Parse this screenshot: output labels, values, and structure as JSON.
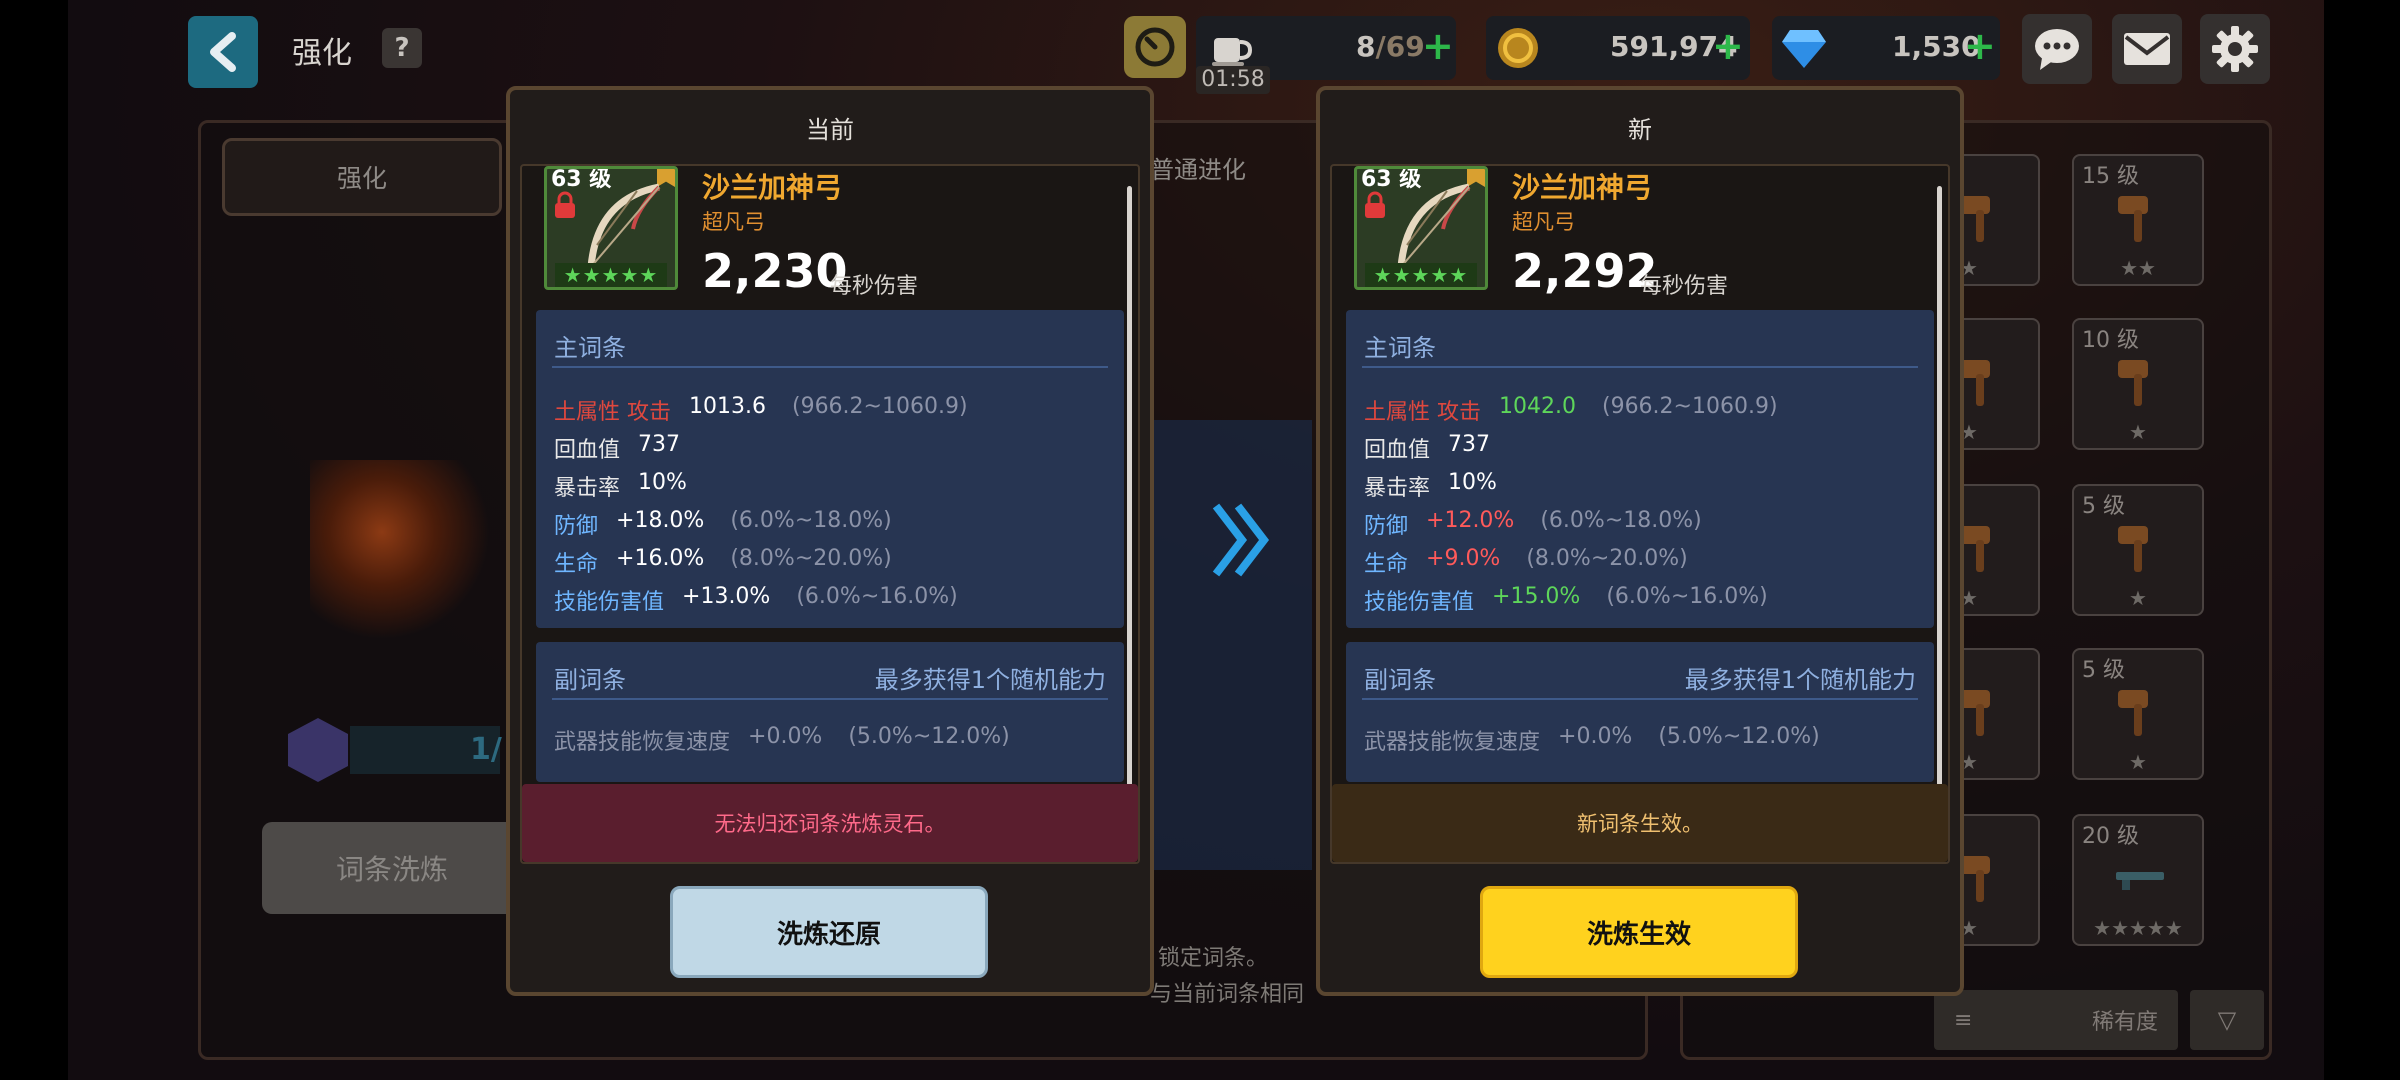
{
  "header": {
    "title": "强化",
    "help": "?",
    "energy": {
      "current": "8",
      "max": "/69",
      "timer": "01:58"
    },
    "gold": "591,974",
    "gems": "1,530"
  },
  "background": {
    "tab_enhance": "强化",
    "tab_evolve": "普通进化",
    "wash_button": "词条洗炼",
    "progress_text": "1/",
    "hint_1": "锁定词条。",
    "hint_2": "与当前词条相同",
    "rarity_label": "稀有度",
    "inventory_levels": [
      "15 级",
      "10 级",
      "5 级",
      "5 级",
      "20 级"
    ],
    "inventory_stars": [
      "★★",
      "★",
      "★",
      "★",
      "★★★★★"
    ]
  },
  "current": {
    "title": "当前",
    "level": "63 级",
    "name": "沙兰加神弓",
    "rarity": "超凡弓",
    "dps": "2,230",
    "dps_label": "每秒伤害",
    "stars": "★★★★★",
    "main_head": "主词条",
    "main": [
      {
        "name": "土属性 攻击",
        "value": "1013.6",
        "range": "(966.2~1060.9)"
      },
      {
        "name": "回血值",
        "value": "737",
        "range": ""
      },
      {
        "name": "暴击率",
        "value": "10%",
        "range": ""
      },
      {
        "name": "防御",
        "value": "+18.0%",
        "range": "(6.0%~18.0%)"
      },
      {
        "name": "生命",
        "value": "+16.0%",
        "range": "(8.0%~20.0%)"
      },
      {
        "name": "技能伤害值",
        "value": "+13.0%",
        "range": "(6.0%~16.0%)"
      }
    ],
    "sub_head": "副词条",
    "sub_note": "最多获得1个随机能力",
    "sub": {
      "name": "武器技能恢复速度",
      "value": "+0.0%",
      "range": "(5.0%~12.0%)"
    },
    "message": "无法归还词条洗炼灵石。",
    "button": "洗炼还原"
  },
  "new": {
    "title": "新",
    "level": "63 级",
    "name": "沙兰加神弓",
    "rarity": "超凡弓",
    "dps": "2,292",
    "dps_label": "每秒伤害",
    "stars": "★★★★★",
    "main_head": "主词条",
    "main": [
      {
        "name": "土属性 攻击",
        "value": "1042.0",
        "range": "(966.2~1060.9)"
      },
      {
        "name": "回血值",
        "value": "737",
        "range": ""
      },
      {
        "name": "暴击率",
        "value": "10%",
        "range": ""
      },
      {
        "name": "防御",
        "value": "+12.0%",
        "range": "(6.0%~18.0%)"
      },
      {
        "name": "生命",
        "value": "+9.0%",
        "range": "(8.0%~20.0%)"
      },
      {
        "name": "技能伤害值",
        "value": "+15.0%",
        "range": "(6.0%~16.0%)"
      }
    ],
    "sub_head": "副词条",
    "sub_note": "最多获得1个随机能力",
    "sub": {
      "name": "武器技能恢复速度",
      "value": "+0.0%",
      "range": "(5.0%~12.0%)"
    },
    "message": "新词条生效。",
    "button": "洗炼生效"
  },
  "colors": {
    "earth_attack_label": "#e0483e",
    "stat_label_white": "#e8e8e8",
    "stat_label_blue": "#6fb6ff",
    "increase": "#5ed65a",
    "decrease": "#ff5a5a",
    "confirm_button": "#ffd21e",
    "revert_button": "#c0d8e6",
    "current_message_bg": "#5a1e2e",
    "new_message_bg": "#3a2a16"
  }
}
